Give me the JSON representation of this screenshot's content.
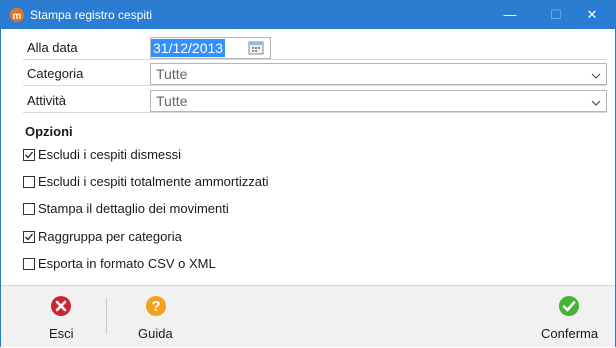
{
  "window": {
    "title": "Stampa registro cespiti",
    "minimize_glyph": "—",
    "maximize_glyph": "☐",
    "close_glyph": "✕"
  },
  "form": {
    "date": {
      "label": "Alla data",
      "value": "31/12/2013"
    },
    "category": {
      "label": "Categoria",
      "value": "Tutte"
    },
    "activity": {
      "label": "Attività",
      "value": "Tutte"
    }
  },
  "options": {
    "title": "Opzioni",
    "items": [
      {
        "label": "Escludi i cespiti dismessi",
        "checked": true
      },
      {
        "label": "Escludi i cespiti totalmente ammortizzati",
        "checked": false
      },
      {
        "label": "Stampa il dettaglio dei movimenti",
        "checked": false
      },
      {
        "label": "Raggruppa per categoria",
        "checked": true
      },
      {
        "label": "Esporta in formato CSV o XML",
        "checked": false
      }
    ]
  },
  "footer": {
    "exit_label": "Esci",
    "help_label": "Guida",
    "confirm_label": "Conferma"
  },
  "colors": {
    "titlebar": "#2b7cd3",
    "selection": "#3390ff",
    "exit": "#c8282d",
    "help": "#f5a01e",
    "confirm": "#46b336"
  }
}
